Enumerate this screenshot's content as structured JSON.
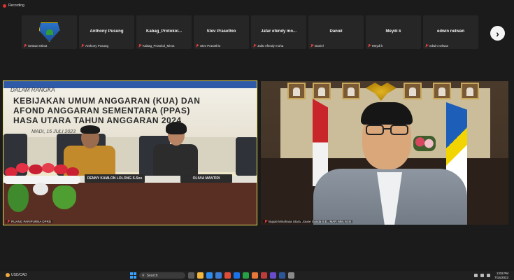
{
  "recording": {
    "label": "Recording"
  },
  "participants": [
    {
      "type": "logo",
      "footer": "Setwan Minut"
    },
    {
      "name": "Anthony Pusung",
      "footer": "Anthony Pusung"
    },
    {
      "name": "Kabag_Protokol...",
      "footer": "Kabag_Protokol_Minut"
    },
    {
      "name": "Stev Prasethio",
      "footer": "Stev Prasethio"
    },
    {
      "name": "Jafar efendy mo...",
      "footer": "Jafar efendy moha"
    },
    {
      "name": "Daniel",
      "footer": "Daniel"
    },
    {
      "name": "Meydi k",
      "footer": "Meydi k"
    },
    {
      "name": "edwin nelwan",
      "footer": "edwin nelwan"
    }
  ],
  "main_left": {
    "banner_line1": "DALAM RANGKA",
    "banner_line2": "KEBIJAKAN UMUM ANGGARAN (KUA) DAN",
    "banner_line3": "AFOND ANGGARAN SEMENTARA (PPAS)",
    "banner_line4": "HASA UTARA TAHUN ANGGARAN 2024",
    "banner_line5": "MADI, 15 JULI 2023",
    "nameplate1": "DENNY KAMLON LOLONG S.Sos",
    "nameplate2": "OLIVIA MANTIRI",
    "label": "RUANG PARIPURNA DPRD"
  },
  "main_right": {
    "label": "Bupati Minahasa Utara, Joune Ganda S.E., MAP, MM, M.Si"
  },
  "taskbar": {
    "weather": "USD/CAD",
    "search_placeholder": "Search",
    "time": "2:03 PM",
    "date": "7/15/2023"
  }
}
